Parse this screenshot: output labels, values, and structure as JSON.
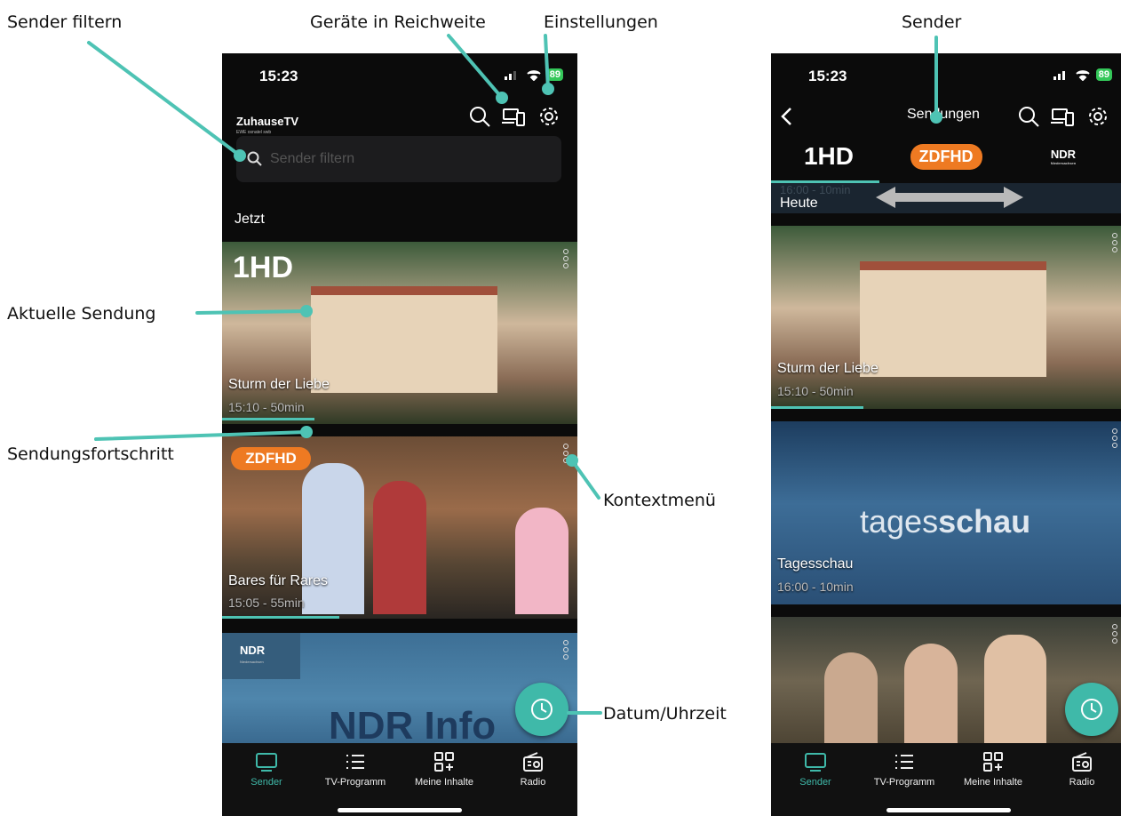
{
  "annotations": {
    "sender_filtern": "Sender filtern",
    "geraete": "Geräte in Reichweite",
    "einstellungen": "Einstellungen",
    "sender": "Sender",
    "aktuelle_sendung": "Aktuelle Sendung",
    "fortschritt": "Sendungsfortschritt",
    "kontextmenue": "Kontextmenü",
    "datum": "Datum/Uhrzeit"
  },
  "left_phone": {
    "time": "15:23",
    "battery": "89",
    "logo": "ZuhauseTV",
    "logo_sub": "EWE osnatel swb",
    "search": {
      "placeholder": "Sender filtern"
    },
    "section": "Jetzt",
    "cards": [
      {
        "channel": "1HD",
        "title": "Sturm der Liebe",
        "time": "15:10 - 50min",
        "progress": 0.26
      },
      {
        "channel": "ZDFHD",
        "title": "Bares für Rares",
        "time": "15:05 - 55min",
        "progress": 0.33
      },
      {
        "channel": "NDR",
        "channel_sub": "Niedersachsen",
        "banner": "NDR Info"
      }
    ]
  },
  "right_phone": {
    "time": "15:23",
    "battery": "89",
    "nav_title": "Sendungen",
    "channels": [
      "1HD",
      "ZDFHD",
      "NDR"
    ],
    "channel_sub": "Niedersachsen",
    "day": "Heute",
    "faded_time": "16:00 - 10min",
    "cards": [
      {
        "title": "Sturm der Liebe",
        "time": "15:10 - 50min",
        "progress": 0.26
      },
      {
        "title": "Tagesschau",
        "time": "16:00 - 10min",
        "brand_light": "tages",
        "brand_bold": "schau"
      },
      {
        "title": "",
        "time": ""
      }
    ]
  },
  "tabbar": [
    {
      "label": "Sender",
      "icon": "tv-icon",
      "active": true
    },
    {
      "label": "TV-Programm",
      "icon": "list-icon"
    },
    {
      "label": "Meine Inhalte",
      "icon": "grid-plus-icon"
    },
    {
      "label": "Radio",
      "icon": "radio-icon"
    }
  ],
  "colors": {
    "accent": "#3fb9a9",
    "background": "#0b0b0b"
  }
}
